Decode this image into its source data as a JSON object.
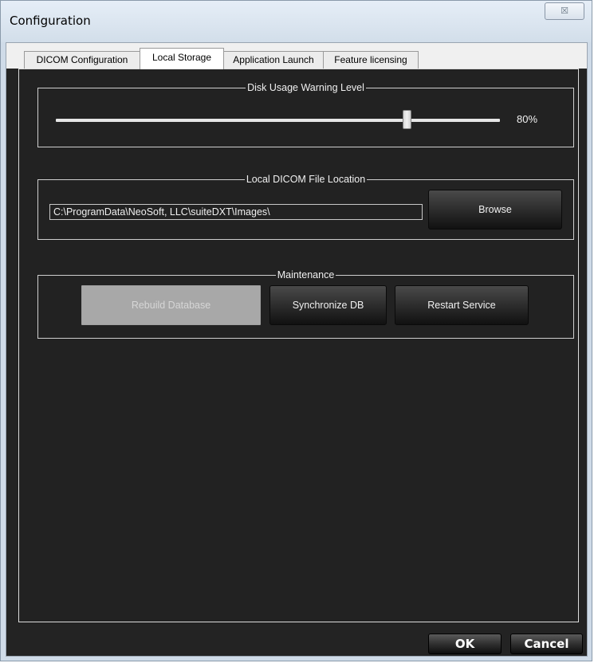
{
  "window": {
    "title": "Configuration",
    "close_glyph": "☒"
  },
  "tabs": [
    {
      "label": "DICOM Configuration",
      "active": false
    },
    {
      "label": "Local Storage",
      "active": true
    },
    {
      "label": "Application Launch",
      "active": false
    },
    {
      "label": "Feature licensing",
      "active": false
    }
  ],
  "disk_usage": {
    "group_title": "Disk Usage Warning Level",
    "value_label": "80%",
    "level_percent": 80
  },
  "file_location": {
    "group_title": "Local DICOM File Location",
    "path_value": "C:\\ProgramData\\NeoSoft, LLC\\suiteDXT\\Images\\",
    "browse_label": "Browse"
  },
  "maintenance": {
    "group_title": "Maintenance",
    "rebuild_label": "Rebuild Database",
    "rebuild_enabled": false,
    "sync_label": "Synchronize DB",
    "restart_label": "Restart Service"
  },
  "footer": {
    "ok_label": "OK",
    "cancel_label": "Cancel"
  },
  "colors": {
    "panel_background": "#222222",
    "disabled_button": "#a8a8a8"
  }
}
